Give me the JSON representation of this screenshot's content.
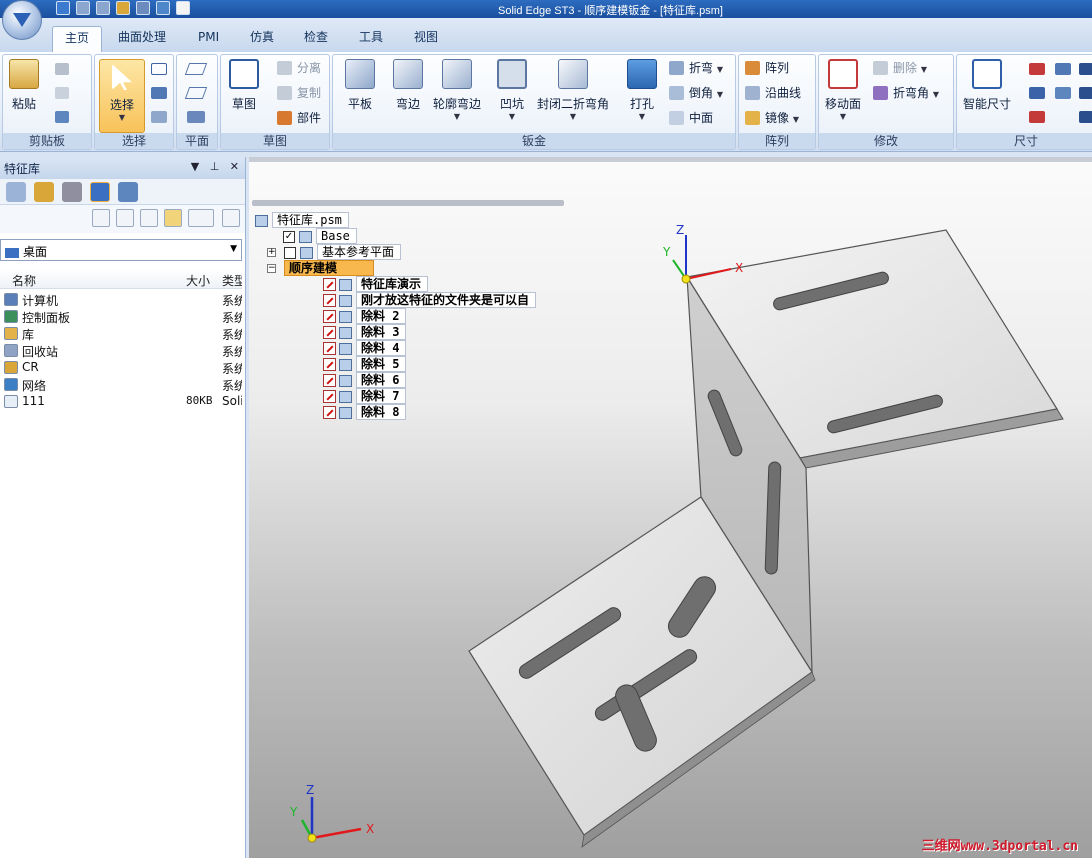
{
  "window": {
    "title": "Solid Edge ST3 - 顺序建模钣金 - [特征库.psm]"
  },
  "tabs": [
    {
      "label": "主页",
      "active": true
    },
    {
      "label": "曲面处理"
    },
    {
      "label": "PMI"
    },
    {
      "label": "仿真"
    },
    {
      "label": "检查"
    },
    {
      "label": "工具"
    },
    {
      "label": "视图"
    }
  ],
  "ribbon": {
    "clipboard": {
      "label": "剪贴板",
      "paste": "粘贴"
    },
    "select": {
      "label": "选择",
      "select": "选择"
    },
    "plane": {
      "label": "平面"
    },
    "sketch": {
      "label": "草图",
      "sketch": "草图",
      "separate": "分离",
      "copy": "复制",
      "part": "部件"
    },
    "sheetmetal": {
      "label": "钣金",
      "tab": "平板",
      "flange": "弯边",
      "contour_flange": "轮廓弯边",
      "dimple": "凹坑",
      "closed_corner": "封闭二折弯角",
      "hole": "打孔",
      "bend": "折弯",
      "chamfer": "倒角",
      "midplane": "中面"
    },
    "pattern": {
      "label": "阵列",
      "pattern": "阵列",
      "along_curve": "沿曲线",
      "mirror": "镜像"
    },
    "modify": {
      "label": "修改",
      "move_face": "移动面",
      "delete": "删除",
      "bend_angle": "折弯角"
    },
    "dimension": {
      "label": "尺寸",
      "smart_dim": "智能尺寸"
    }
  },
  "left_panel": {
    "title": "特征库",
    "location": "桌面",
    "columns": {
      "name": "名称",
      "size": "大小",
      "type": "类型"
    },
    "files": [
      {
        "name": "计算机",
        "size": "",
        "type": "系统文件夹",
        "color": "#5b7fb8"
      },
      {
        "name": "控制面板",
        "size": "",
        "type": "系统文件夹",
        "color": "#3a8f5a"
      },
      {
        "name": "库",
        "size": "",
        "type": "系统文件夹",
        "color": "#e3b34a"
      },
      {
        "name": "回收站",
        "size": "",
        "type": "系统文件夹",
        "color": "#8fa4c4"
      },
      {
        "name": "CR",
        "size": "",
        "type": "系统文件夹",
        "color": "#d9a63a"
      },
      {
        "name": "网络",
        "size": "",
        "type": "系统文件夹",
        "color": "#3d7fc4"
      },
      {
        "name": "111",
        "size": "80KB",
        "type": "Solid Edge",
        "color": "#e8eef8"
      }
    ]
  },
  "tree": {
    "root": "特征库.psm",
    "base": "Base",
    "ref_planes": "基本参考平面",
    "ordered": "顺序建模",
    "items": [
      "特征库演示",
      "刚才放这特征的文件夹是可以自",
      "除料 2",
      "除料 3",
      "除料 4",
      "除料 5",
      "除料 6",
      "除料 7",
      "除料 8"
    ]
  },
  "triad_labels": {
    "x": "X",
    "y": "Y",
    "z": "Z"
  },
  "watermark": "三维网www.3dportal.cn",
  "colors": {
    "accent": "#1a4f9e",
    "highlight": "#f9b84d",
    "x_axis": "#e0191b",
    "y_axis": "#1eb52a",
    "z_axis": "#1f35c8"
  }
}
